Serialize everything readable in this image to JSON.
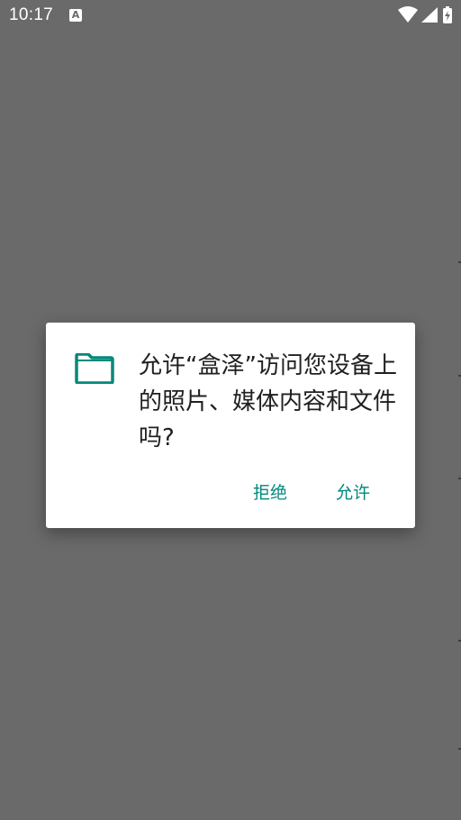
{
  "status_bar": {
    "time": "10:17",
    "app_icon_glyph": "A",
    "icons": [
      "wifi-icon",
      "signal-icon",
      "battery-charging-icon"
    ]
  },
  "dialog": {
    "icon": "folder-icon",
    "message": "允许“盒泽”访问您设备上的照片、媒体内容和文件吗?",
    "deny_label": "拒绝",
    "allow_label": "允许"
  },
  "colors": {
    "scrim": "#6a6a6a",
    "accent": "#00897b",
    "dialog_bg": "#ffffff",
    "text": "#202020"
  }
}
